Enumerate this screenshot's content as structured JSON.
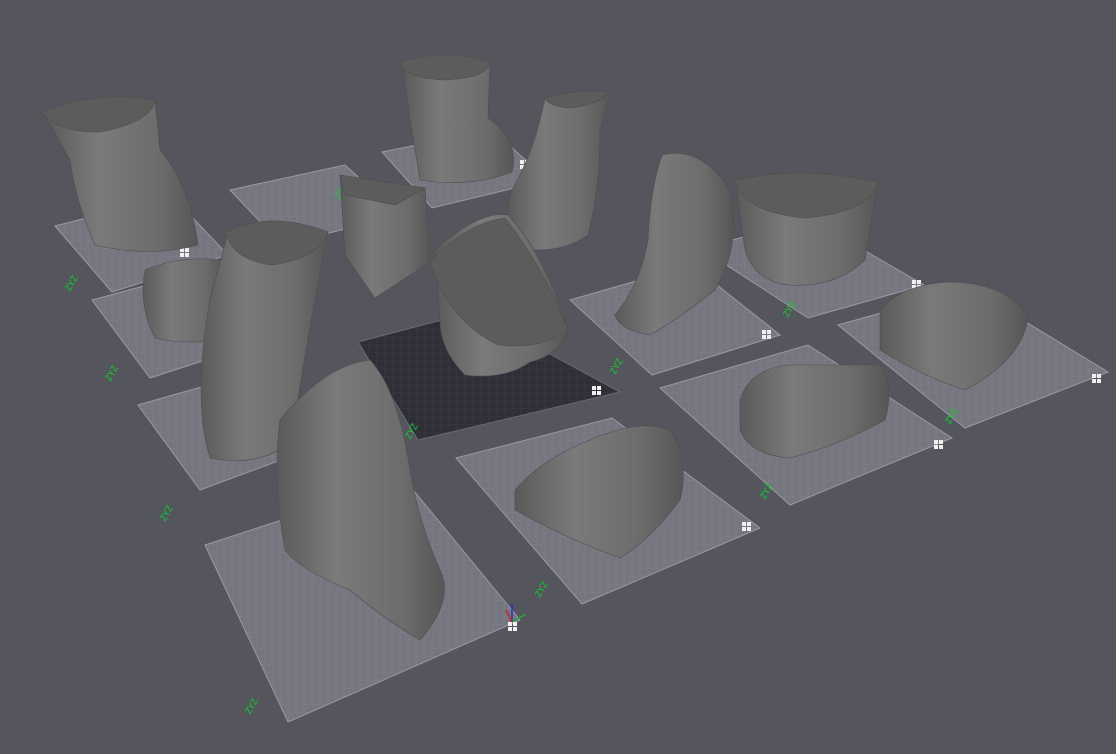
{
  "viewport": {
    "background": "#55555e",
    "plate_color": "#767680",
    "active_plate_color": "#2f2f38",
    "model_color": "#6a6a6a",
    "model_cap_color": "#5c5c5c",
    "label_color": "#0dcf2a"
  },
  "plates": [
    {
      "id": 1,
      "label": "ZYZ",
      "active": false,
      "model": "ankle-column"
    },
    {
      "id": 2,
      "label": "ZYZ",
      "active": false,
      "model": "wedge"
    },
    {
      "id": 3,
      "label": "ZYZ",
      "active": false,
      "model": "ankle-column"
    },
    {
      "id": 4,
      "label": "ZYZ",
      "active": false,
      "model": "leg-column"
    },
    {
      "id": 5,
      "label": "ZYZ",
      "active": false,
      "model": "foot-toes"
    },
    {
      "id": 6,
      "label": "ZYZ",
      "active": false,
      "model": "block"
    },
    {
      "id": 7,
      "label": "ZYZ",
      "active": false,
      "model": "tall-column"
    },
    {
      "id": 8,
      "label": "ZYZ",
      "active": true,
      "model": "cut-sphere"
    },
    {
      "id": 9,
      "label": "ZYZ",
      "active": false,
      "model": "half-dome"
    },
    {
      "id": 10,
      "label": "ZYZ",
      "active": false,
      "model": "half-cylinder"
    },
    {
      "id": 11,
      "label": "ZYZ",
      "active": false,
      "model": "foot-toes"
    },
    {
      "id": 12,
      "label": "ZYZ",
      "active": false,
      "model": "half-dome"
    }
  ],
  "icons": {
    "axis_gizmo": "axis-gizmo-icon",
    "plate_grid": "plate-grid-icon"
  }
}
